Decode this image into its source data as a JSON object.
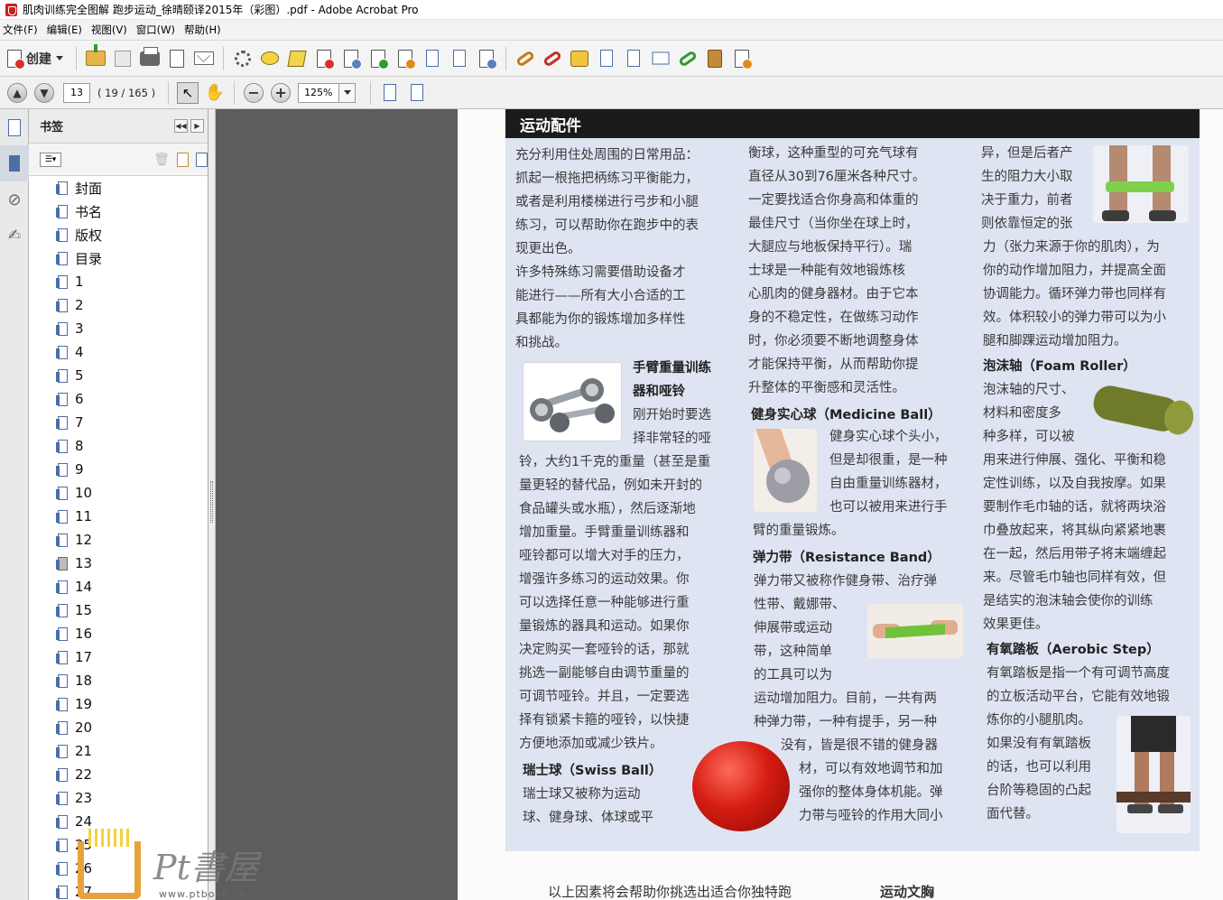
{
  "window": {
    "title": "肌肉训练完全图解 跑步运动_徐晴颐译2015年（彩图）.pdf - Adobe Acrobat Pro"
  },
  "menu": [
    "文件(F)",
    "编辑(E)",
    "视图(V)",
    "窗口(W)",
    "帮助(H)"
  ],
  "toolbar": {
    "create_label": "创建"
  },
  "nav": {
    "page_value": "13",
    "page_count": "( 19 / 165 )",
    "zoom_value": "125%"
  },
  "bookmarks": {
    "title": "书签",
    "items": [
      "封面",
      "书名",
      "版权",
      "目录",
      "1",
      "2",
      "3",
      "4",
      "5",
      "6",
      "7",
      "8",
      "9",
      "10",
      "11",
      "12",
      "13",
      "14",
      "15",
      "16",
      "17",
      "18",
      "19",
      "20",
      "21",
      "22",
      "23",
      "24",
      "25",
      "26",
      "27"
    ],
    "current": "13"
  },
  "pdf": {
    "section_title": "运动配件",
    "col1": [
      "充分利用住处周围的日常用品：",
      "抓起一根拖把柄练习平衡能力，",
      "或者是利用楼梯进行弓步和小腿",
      "练习，可以帮助你在跑步中的表",
      "现更出色。",
      "许多特殊练习需要借助设备才",
      "能进行——所有大小合适的工",
      "具都能为你的锻炼增加多样性",
      "和挑战。"
    ],
    "dumbbell_heading": [
      "手臂重量训练",
      "器和哑铃"
    ],
    "dumbbell_side": [
      "刚开始时要选",
      "择非常轻的哑"
    ],
    "col1b": [
      "铃，大约1千克的重量（甚至是重",
      "量更轻的替代品，例如未开封的",
      "食品罐头或水瓶），然后逐渐地",
      "增加重量。手臂重量训练器和",
      "哑铃都可以增大对手的压力，",
      "增强许多练习的运动效果。你",
      "可以选择任意一种能够进行重",
      "量锻炼的器具和运动。如果你",
      "决定购买一套哑铃的话，那就",
      "挑选一副能够自由调节重量的",
      "可调节哑铃。并且，一定要选",
      "择有锁紧卡箍的哑铃，以快捷",
      "方便地添加或减少铁片。"
    ],
    "swiss_heading": "瑞士球（Swiss Ball）",
    "swiss_lines": [
      "瑞士球又被称为运动",
      "球、健身球、体球或平"
    ],
    "col2": [
      "衡球，这种重型的可充气球有",
      "直径从30到76厘米各种尺寸。",
      "一定要找适合你身高和体重的",
      "最佳尺寸（当你坐在球上时，",
      "大腿应与地板保持平行）。瑞",
      "士球是一种能有效地锻炼核",
      "心肌肉的健身器材。由于它本",
      "身的不稳定性，在做练习动作",
      "时，你必须要不断地调整身体",
      "才能保持平衡，从而帮助你提",
      "升整体的平衡感和灵活性。"
    ],
    "medball_heading": "健身实心球（Medicine Ball）",
    "medball_side": [
      "健身实心球个头小，",
      "但是却很重，是一种",
      "自由重量训练器材，",
      "也可以被用来进行手"
    ],
    "medball_tail": "臂的重量锻炼。",
    "band_heading": "弹力带（Resistance Band）",
    "band_lines": [
      "弹力带又被称作健身带、治疗弹",
      "性带、戴娜带、"
    ],
    "band_side": [
      "伸展带或运动",
      "带，这种简单",
      "的工具可以为"
    ],
    "band_more": [
      "运动增加阻力。目前，一共有两",
      "种弹力带，一种有提手，另一种"
    ],
    "band_right": [
      "没有，皆是很不错的健身器",
      "材，可以有效地调节和加",
      "强你的整体身体机能。弹",
      "力带与哑铃的作用大同小"
    ],
    "col3_top": [
      "异，但是后者产",
      "生的阻力大小取",
      "决于重力，前者",
      "则依靠恒定的张"
    ],
    "col3": [
      "力（张力来源于你的肌肉），为",
      "你的动作增加阻力，并提高全面",
      "协调能力。循环弹力带也同样有",
      "效。体积较小的弹力带可以为小",
      "腿和脚踝运动增加阻力。"
    ],
    "foam_heading": "泡沫轴（Foam Roller）",
    "foam_side": [
      "泡沫轴的尺寸、",
      "材料和密度多",
      "种多样，可以被"
    ],
    "foam_lines": [
      "用来进行伸展、强化、平衡和稳",
      "定性训练，以及自我按摩。如果",
      "要制作毛巾轴的话，就将两块浴",
      "巾叠放起来，将其纵向紧紧地裹",
      "在一起，然后用带子将末端缠起",
      "来。尽管毛巾轴也同样有效，但",
      "是结实的泡沫轴会使你的训练",
      "效果更佳。"
    ],
    "step_heading": "有氧踏板（Aerobic Step）",
    "step_lines": [
      "有氧踏板是指一个有可调节高度",
      "的立板活动平台，它能有效地锻",
      "炼你的小腿肌肉。"
    ],
    "step_side": [
      "如果没有有氧踏板",
      "的话，也可以利用",
      "台阶等稳固的凸起",
      "面代替。"
    ],
    "bottom_left": "以上因素将会帮助你挑选出适合你独特跑",
    "bottom_right": "运动文胸"
  },
  "watermark": {
    "text": "Pt書屋",
    "url": "www.ptbook.cn"
  },
  "colors": {
    "header_bg": "#1b1b1b",
    "page_tint": "#dfe4f2",
    "viewer_bg": "#5d5d5d"
  }
}
